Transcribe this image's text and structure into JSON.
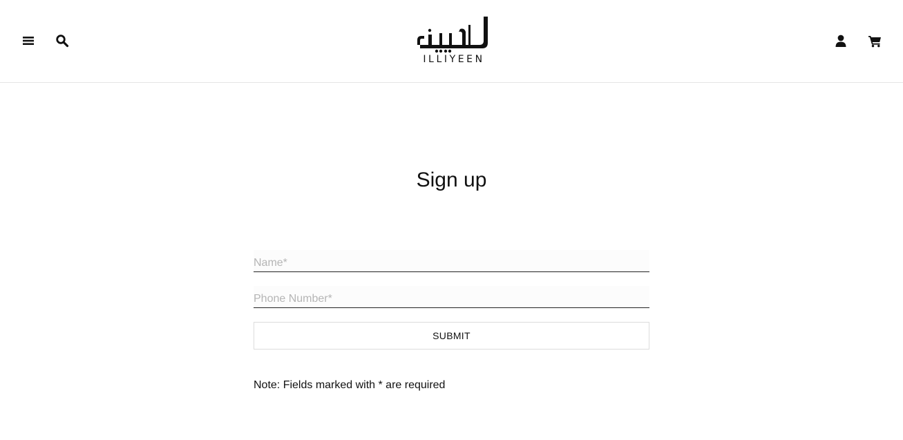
{
  "header": {
    "logo_text": "ILLIYEEN",
    "icons": {
      "menu": "hamburger-menu-icon",
      "search": "search-icon",
      "account": "user-icon",
      "cart": "shopping-cart-icon"
    }
  },
  "main": {
    "title": "Sign up",
    "form": {
      "name_placeholder": "Name*",
      "name_value": "",
      "phone_placeholder": "Phone Number*",
      "phone_value": "",
      "submit_label": "SUBMIT"
    },
    "note": "Note: Fields marked with * are required"
  },
  "colors": {
    "text": "#111111",
    "border": "#e4e4e4",
    "background": "#ffffff"
  }
}
